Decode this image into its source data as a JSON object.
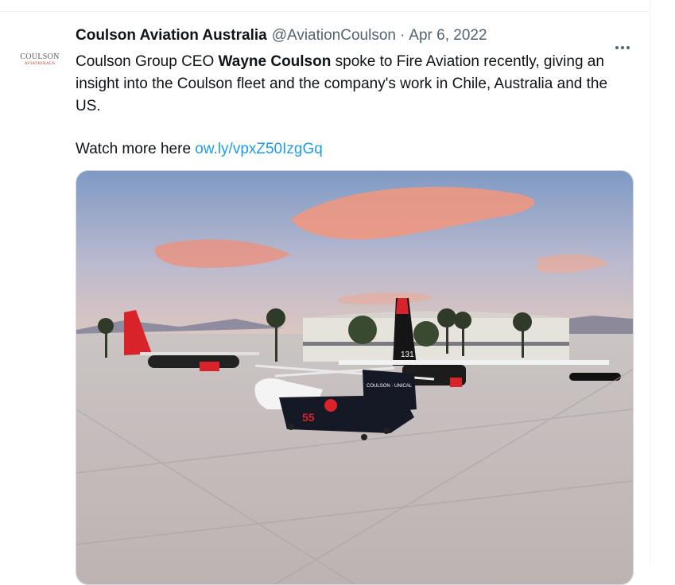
{
  "tweet": {
    "author_name": "Coulson Aviation Australia",
    "handle": "@AviationCoulson",
    "separator": "·",
    "date": "Apr 6, 2022",
    "avatar": {
      "line1": "COULSON",
      "line2": "AVIATIONAUS"
    },
    "text": {
      "p1_before": "Coulson Group CEO ",
      "p1_bold": "Wayne Coulson",
      "p1_after": " spoke to Fire Aviation recently, giving an insight into the Coulson fleet and the company's work in Chile, Australia and the US.",
      "p2_before": "Watch more here ",
      "p2_link": "ow.ly/vpxZ50IzgGq"
    },
    "more_icon": "more-horizontal-icon"
  },
  "media": {
    "helicopter_number": "55",
    "helicopter_brand": "COULSON · UNICAL",
    "tail_number": "131",
    "accent_red": "#d8232a",
    "sky_top": "#7f9ac4",
    "cloud_color": "#f08f78"
  }
}
